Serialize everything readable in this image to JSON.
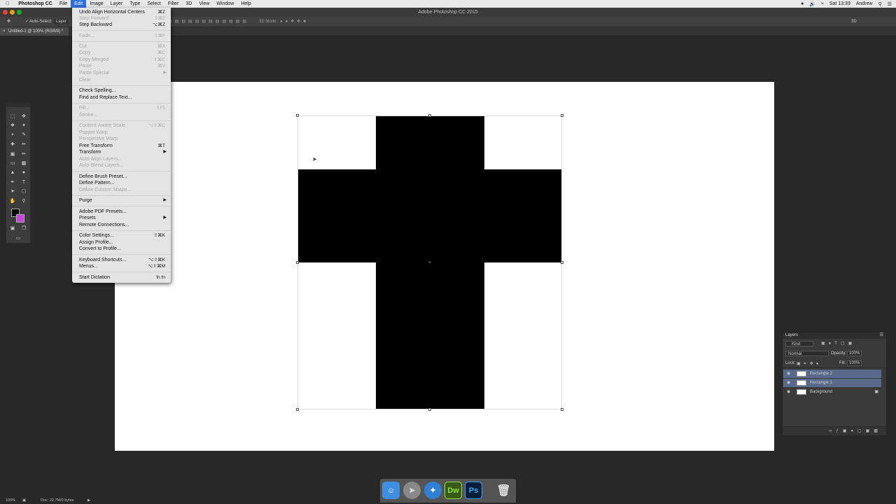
{
  "menubar": {
    "items": [
      "Photoshop CC",
      "File",
      "Edit",
      "Image",
      "Layer",
      "Type",
      "Select",
      "Filter",
      "3D",
      "View",
      "Window",
      "Help"
    ],
    "active": "Edit",
    "clock": "Sat 13:39",
    "user": "Andrew"
  },
  "window": {
    "title": "Adobe Photoshop CC 2015"
  },
  "options": {
    "auto_select": "Auto-Select:",
    "layer_select": "Layer",
    "mode_3d": "3D Mode:",
    "workspace": "3D"
  },
  "document": {
    "tab": "Untitled-1 @ 100% (RGB/8) *"
  },
  "edit_menu": {
    "items": [
      {
        "label": "Undo Align Horizontal Centers",
        "shortcut": "⌘Z",
        "enabled": true
      },
      {
        "label": "Step Forward",
        "shortcut": "⇧⌘Z",
        "enabled": false
      },
      {
        "label": "Step Backward",
        "shortcut": "⌥⌘Z",
        "enabled": true
      },
      {
        "label": "Fade...",
        "shortcut": "⇧⌘F",
        "enabled": false
      },
      {
        "label": "Cut",
        "shortcut": "⌘X",
        "enabled": false
      },
      {
        "label": "Copy",
        "shortcut": "⌘C",
        "enabled": false
      },
      {
        "label": "Copy Merged",
        "shortcut": "⇧⌘C",
        "enabled": false
      },
      {
        "label": "Paste",
        "shortcut": "⌘V",
        "enabled": false
      },
      {
        "label": "Paste Special",
        "shortcut": "",
        "enabled": false,
        "submenu": true
      },
      {
        "label": "Clear",
        "shortcut": "",
        "enabled": false
      },
      {
        "label": "Check Spelling...",
        "shortcut": "",
        "enabled": true
      },
      {
        "label": "Find and Replace Text...",
        "shortcut": "",
        "enabled": true
      },
      {
        "label": "Fill...",
        "shortcut": "⇧F5",
        "enabled": false
      },
      {
        "label": "Stroke...",
        "shortcut": "",
        "enabled": false
      },
      {
        "label": "Content-Aware Scale",
        "shortcut": "⌥⇧⌘C",
        "enabled": false
      },
      {
        "label": "Puppet Warp",
        "shortcut": "",
        "enabled": false
      },
      {
        "label": "Perspective Warp",
        "shortcut": "",
        "enabled": false
      },
      {
        "label": "Free Transform",
        "shortcut": "⌘T",
        "enabled": true
      },
      {
        "label": "Transform",
        "shortcut": "",
        "enabled": true,
        "submenu": true
      },
      {
        "label": "Auto-Align Layers...",
        "shortcut": "",
        "enabled": false
      },
      {
        "label": "Auto-Blend Layers...",
        "shortcut": "",
        "enabled": false
      },
      {
        "label": "Define Brush Preset...",
        "shortcut": "",
        "enabled": true
      },
      {
        "label": "Define Pattern...",
        "shortcut": "",
        "enabled": true
      },
      {
        "label": "Define Custom Shape...",
        "shortcut": "",
        "enabled": false
      },
      {
        "label": "Purge",
        "shortcut": "",
        "enabled": true,
        "submenu": true
      },
      {
        "label": "Adobe PDF Presets...",
        "shortcut": "",
        "enabled": true
      },
      {
        "label": "Presets",
        "shortcut": "",
        "enabled": true,
        "submenu": true
      },
      {
        "label": "Remote Connections...",
        "shortcut": "",
        "enabled": true
      },
      {
        "label": "Color Settings...",
        "shortcut": "⇧⌘K",
        "enabled": true
      },
      {
        "label": "Assign Profile...",
        "shortcut": "",
        "enabled": true
      },
      {
        "label": "Convert to Profile...",
        "shortcut": "",
        "enabled": true
      },
      {
        "label": "Keyboard Shortcuts...",
        "shortcut": "⌥⇧⌘K",
        "enabled": true
      },
      {
        "label": "Menus...",
        "shortcut": "⌥⇧⌘M",
        "enabled": true
      },
      {
        "label": "Start Dictation",
        "shortcut": "fn fn",
        "enabled": true
      }
    ]
  },
  "layers_panel": {
    "title": "Layers",
    "filter": "Kind",
    "blend_mode": "Normal",
    "opacity_label": "Opacity:",
    "opacity": "100%",
    "lock_label": "Lock:",
    "fill_label": "Fill:",
    "fill": "100%",
    "layers": [
      {
        "name": "Rectangle 2",
        "selected": true
      },
      {
        "name": "Rectangle 1",
        "selected": true
      },
      {
        "name": "Background",
        "selected": false
      }
    ]
  },
  "status": {
    "zoom": "100%",
    "doc": "Doc: 22.7M/0 bytes"
  },
  "dock": {
    "apps": [
      "Finder",
      "Launchpad",
      "Safari",
      "Dw",
      "Ps",
      "Trash"
    ]
  }
}
